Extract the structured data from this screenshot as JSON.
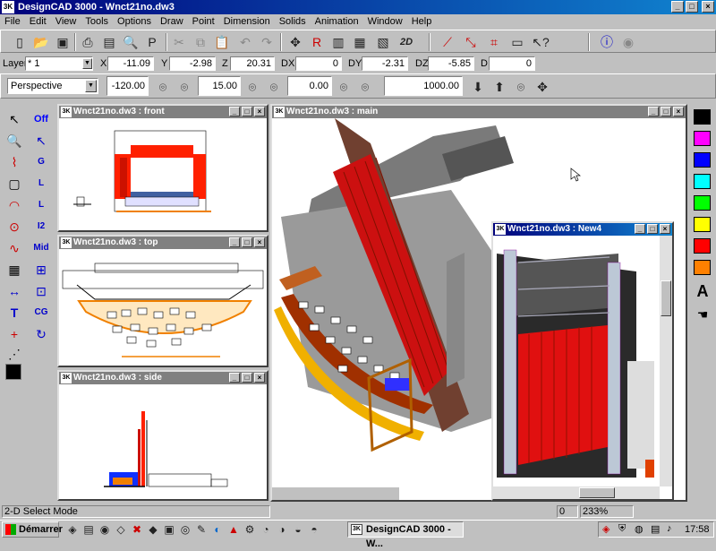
{
  "app": {
    "title": "DesignCAD 3000 - Wnct21no.dw3",
    "icon_label": "3K"
  },
  "menu": [
    "File",
    "Edit",
    "View",
    "Tools",
    "Options",
    "Draw",
    "Point",
    "Dimension",
    "Solids",
    "Animation",
    "Window",
    "Help"
  ],
  "coords": {
    "layer_label": "Layer",
    "layer_value": "* 1",
    "x_label": "X",
    "x": "-11.09",
    "y_label": "Y",
    "y": "-2.98",
    "z_label": "Z",
    "z": "20.31",
    "dx_label": "DX",
    "dx": "0",
    "dy_label": "DY",
    "dy": "-2.31",
    "dz_label": "DZ",
    "dz": "-5.85",
    "d_label": "D",
    "d": "0"
  },
  "view": {
    "mode": "Perspective",
    "angle1": "-120.00",
    "angle2": "15.00",
    "angle3": "0.00",
    "distance": "1000.00"
  },
  "toolbar": {
    "twod_label": "2D"
  },
  "palette": {
    "off_label": "Off",
    "g_label": "G",
    "l_label": "L",
    "i2_label": "I2",
    "mid_label": "Mid",
    "cg_label": "CG"
  },
  "windows": {
    "front": "Wnct21no.dw3 : front",
    "top": "Wnct21no.dw3 : top",
    "side": "Wnct21no.dw3 : side",
    "main": "Wnct21no.dw3 : main",
    "new4": "Wnct21no.dw3 : New4"
  },
  "colors": [
    "#000000",
    "#ff00ff",
    "#0000ff",
    "#00ffff",
    "#00ff00",
    "#ffff00",
    "#ff0000",
    "#ff8000"
  ],
  "status": {
    "mode": "2-D Select Mode",
    "value1": "0",
    "zoom": "233%"
  },
  "taskbar": {
    "start": "Démarrer",
    "task": "DesignCAD 3000 - W...",
    "clock": "17:58"
  }
}
